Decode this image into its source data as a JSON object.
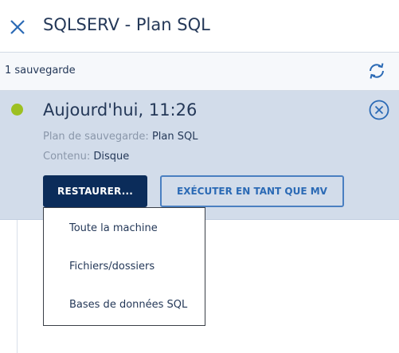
{
  "header": {
    "title": "SQLSERV - Plan SQL",
    "close_icon": "close-icon"
  },
  "subbar": {
    "count_label": "1 sauvegarde",
    "refresh_icon": "refresh-icon"
  },
  "backup": {
    "status_color": "#9dc021",
    "date": "Aujourd'hui, 11:26",
    "plan_key": "Plan de sauvegarde:",
    "plan_value": "Plan SQL",
    "content_key": "Contenu:",
    "content_value": "Disque",
    "restore_label": "RESTAURER...",
    "run_vm_label": "EXÉCUTER EN TANT QUE MV"
  },
  "restore_menu": {
    "items": [
      "Toute la machine",
      "Fichiers/dossiers",
      "Bases de données SQL"
    ]
  },
  "colors": {
    "accent": "#2b6ab5",
    "primary_button": "#0b2c5a",
    "card_background": "#d2dcea"
  }
}
